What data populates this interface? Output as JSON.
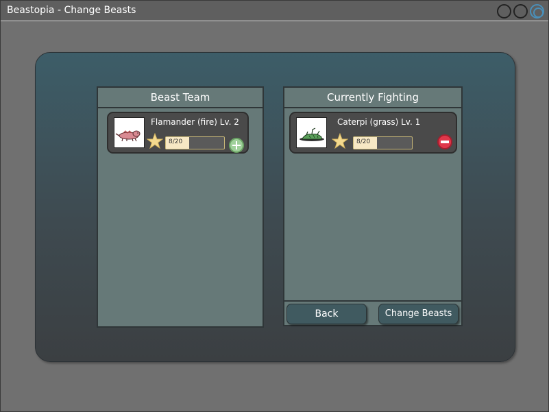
{
  "window": {
    "title": "Beastopia - Change Beasts"
  },
  "team_panel": {
    "header": "Beast Team",
    "beasts": [
      {
        "name": "Flamander (fire) Lv. 2",
        "xp_text": "8/20",
        "xp_fraction": 0.4,
        "action_icon": "plus-circle-icon",
        "portrait_icon": "flamander-portrait"
      }
    ]
  },
  "fighting_panel": {
    "header": "Currently Fighting",
    "beasts": [
      {
        "name": "Caterpi (grass) Lv. 1",
        "xp_text": "8/20",
        "xp_fraction": 0.4,
        "action_icon": "minus-circle-icon",
        "portrait_icon": "caterpi-portrait"
      }
    ],
    "buttons": {
      "back_label": "Back",
      "change_label": "Change Beasts"
    }
  },
  "colors": {
    "add_button": "#9fd09a",
    "remove_button": "#e0374a",
    "star": "#f3d98f",
    "xp_fill": "#f7e8c4"
  }
}
